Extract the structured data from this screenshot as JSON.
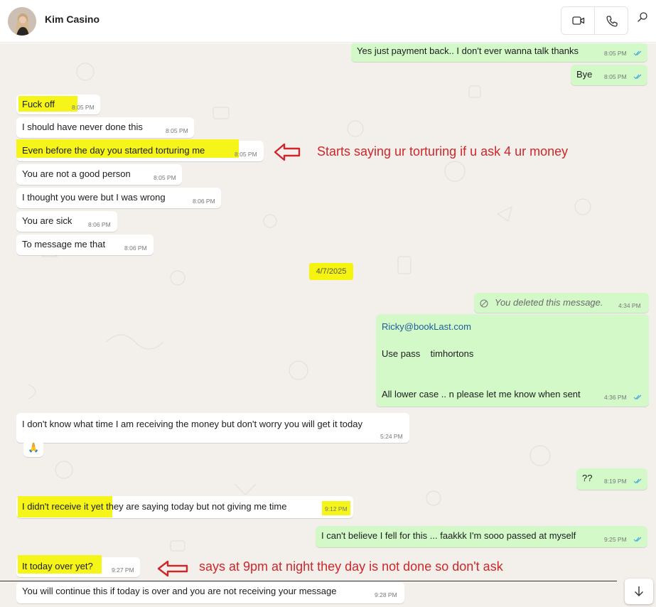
{
  "header": {
    "contact_name": "Kim Casino",
    "avatar_icon": "profile-photo",
    "video_call_icon": "video-camera-icon",
    "voice_call_icon": "phone-icon",
    "search_icon": "search-icon"
  },
  "colors": {
    "chat_bg": "#f3f0ec",
    "incoming_bubble": "#ffffff",
    "outgoing_bubble": "#d3f9c9",
    "highlight": "#f5f519",
    "annotation_red": "#d0262a",
    "read_tick": "#4fa8e0"
  },
  "messages": [
    {
      "dir": "out",
      "text": "Yes just payment back.. I don't ever wanna talk thanks",
      "time": "8:05 PM"
    },
    {
      "dir": "out",
      "text": "Bye",
      "time": "8:05 PM"
    },
    {
      "dir": "in",
      "text": "Fuck off",
      "time": "8:05 PM"
    },
    {
      "dir": "in",
      "text": "I should have never done this",
      "time": "8:05 PM"
    },
    {
      "dir": "in",
      "text": "Even before the day you started torturing me",
      "time": "8:05 PM"
    },
    {
      "dir": "in",
      "text": "You are not a good person",
      "time": "8:05 PM"
    },
    {
      "dir": "in",
      "text": "I thought you were but I was wrong",
      "time": "8:06 PM"
    },
    {
      "dir": "in",
      "text": "You are sick",
      "time": "8:06 PM"
    },
    {
      "dir": "in",
      "text": "To message me that",
      "time": "8:06 PM"
    },
    {
      "dir": "out",
      "text": "You deleted this message.",
      "time": "4:34 PM"
    },
    {
      "dir": "out",
      "lines": [
        "Ricky@bookLast.com",
        "Use pass    timhortons",
        "All lower case .. n please let me know when sent"
      ],
      "time": "4:36 PM"
    },
    {
      "dir": "in",
      "text": "I don't know what time I am receiving the money but don't worry you will get it today",
      "time": "5:24 PM"
    },
    {
      "dir": "in",
      "text": "🙏"
    },
    {
      "dir": "out",
      "text": "??",
      "time": "8:19 PM"
    },
    {
      "dir": "in",
      "text_highlight": "I didn't receive it yet",
      "text_rest": " they are saying today but not giving me time",
      "time": "9:12 PM"
    },
    {
      "dir": "out",
      "text": "I can't believe I fell for this ... faakkk I'm sooo passed at myself",
      "time": "9:25 PM"
    },
    {
      "dir": "in",
      "text": "It today over yet?",
      "time": "9:27 PM"
    },
    {
      "dir": "in",
      "text": "You will continue this if today is over and you are not receiving your message",
      "time": "9:28 PM"
    }
  ],
  "date_separator": "4/7/2025",
  "annotations": [
    {
      "text": "Starts saying ur torturing if u ask 4 ur money"
    },
    {
      "text": "says at 9pm at night they day is not done so don't ask"
    }
  ],
  "scroll_down_icon": "arrow-down-icon"
}
